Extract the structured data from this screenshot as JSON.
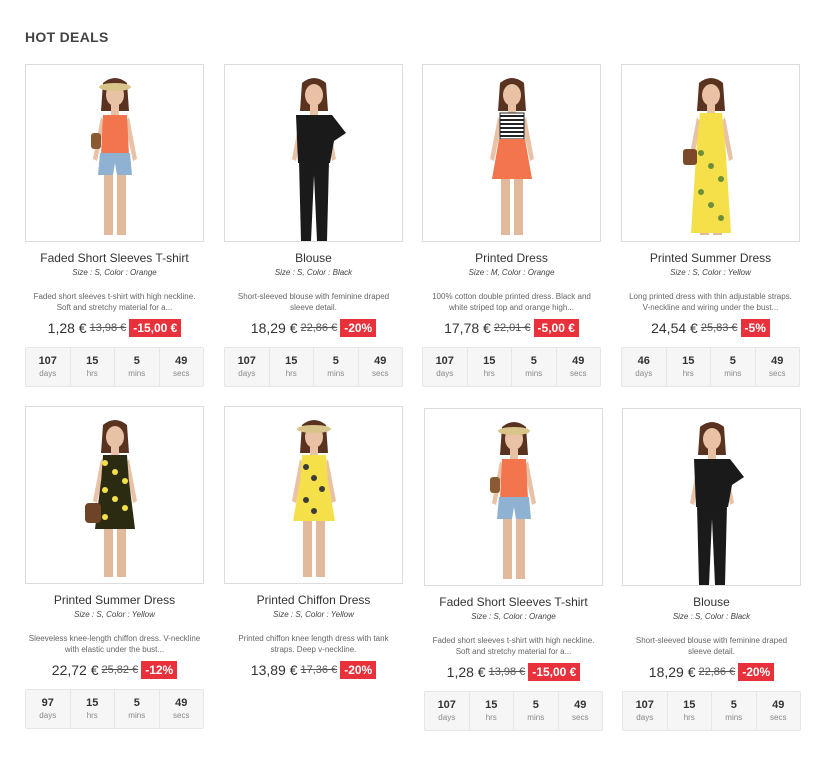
{
  "section": {
    "title": "HOT DEALS"
  },
  "countdown_labels": {
    "days": "days",
    "hrs": "hrs",
    "mins": "mins",
    "secs": "secs"
  },
  "colors": {
    "badge": "#e8313a",
    "orange": "#f2754e",
    "black": "#1a1a1a",
    "yellow": "#f5e04a",
    "denim": "#8fb2d3"
  },
  "products": [
    {
      "name": "Faded Short Sleeves T-shirt",
      "attributes": "Size : S, Color : Orange",
      "description": "Faded short sleeves t-shirt with high neckline. Soft and stretchy material for a...",
      "price": "1,28 €",
      "old_price": "13,98 €",
      "discount": "-15,00 €",
      "countdown": {
        "days": "107",
        "hrs": "15",
        "mins": "5",
        "secs": "49"
      },
      "image_icon": "woman-orange-tank-jeans-shorts-icon"
    },
    {
      "name": "Blouse",
      "attributes": "Size : S, Color : Black",
      "description": "Short-sleeved blouse with feminine draped sleeve detail.",
      "price": "18,29 €",
      "old_price": "22,86 €",
      "discount": "-20%",
      "countdown": {
        "days": "107",
        "hrs": "15",
        "mins": "5",
        "secs": "49"
      },
      "image_icon": "woman-black-blouse-icon"
    },
    {
      "name": "Printed Dress",
      "attributes": "Size : M, Color : Orange",
      "description": "100% cotton double printed dress. Black and white striped top and orange high...",
      "price": "17,78 €",
      "old_price": "22,01 €",
      "discount": "-5,00 €",
      "countdown": {
        "days": "107",
        "hrs": "15",
        "mins": "5",
        "secs": "49"
      },
      "image_icon": "woman-striped-orange-dress-icon"
    },
    {
      "name": "Printed Summer Dress",
      "attributes": "Size : S, Color : Yellow",
      "description": "Long printed dress with thin adjustable straps. V-neckline and wiring under the bust...",
      "price": "24,54 €",
      "old_price": "25,83 €",
      "discount": "-5%",
      "countdown": {
        "days": "46",
        "hrs": "15",
        "mins": "5",
        "secs": "49"
      },
      "image_icon": "woman-long-yellow-dress-icon"
    },
    {
      "name": "Printed Summer Dress",
      "attributes": "Size : S, Color : Yellow",
      "description": "Sleeveless knee-length chiffon dress. V-neckline with elastic under the bust...",
      "price": "22,72 €",
      "old_price": "25,82 €",
      "discount": "-12%",
      "countdown": {
        "days": "97",
        "hrs": "15",
        "mins": "5",
        "secs": "49"
      },
      "image_icon": "woman-black-yellow-print-dress-icon"
    },
    {
      "name": "Printed Chiffon Dress",
      "attributes": "Size : S, Color : Yellow",
      "description": "Printed chiffon knee length dress with tank straps. Deep v-neckline.",
      "price": "13,89 €",
      "old_price": "17,36 €",
      "discount": "-20%",
      "countdown": null,
      "image_icon": "woman-yellow-chiffon-dress-hat-icon"
    },
    {
      "name": "Faded Short Sleeves T-shirt",
      "attributes": "Size : S, Color : Orange",
      "description": "Faded short sleeves t-shirt with high neckline. Soft and stretchy material for a...",
      "price": "1,28 €",
      "old_price": "13,98 €",
      "discount": "-15,00 €",
      "countdown": {
        "days": "107",
        "hrs": "15",
        "mins": "5",
        "secs": "49"
      },
      "image_icon": "woman-orange-tank-jeans-shorts-icon"
    },
    {
      "name": "Blouse",
      "attributes": "Size : S, Color : Black",
      "description": "Short-sleeved blouse with feminine draped sleeve detail.",
      "price": "18,29 €",
      "old_price": "22,86 €",
      "discount": "-20%",
      "countdown": {
        "days": "107",
        "hrs": "15",
        "mins": "5",
        "secs": "49"
      },
      "image_icon": "woman-black-blouse-icon"
    }
  ]
}
